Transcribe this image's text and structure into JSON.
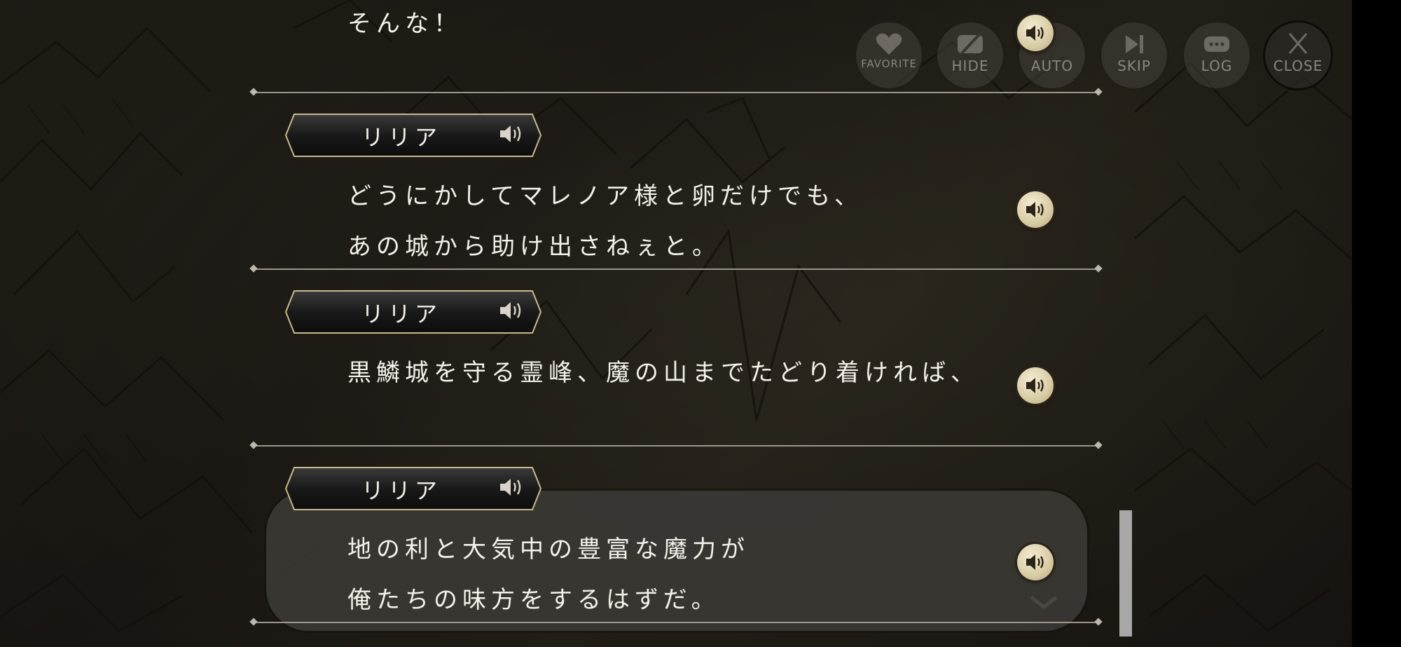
{
  "controls": {
    "favorite": "FAVORITE",
    "hide": "HIDE",
    "auto": "AUTO",
    "skip": "SKIP",
    "log": "LOG",
    "close": "CLOSE"
  },
  "log": {
    "top_fragment": "そんな！",
    "entries": [
      {
        "speaker": "リリア",
        "lines": [
          "どうにかしてマレノア様と卵だけでも、",
          "あの城から助け出さねぇと。"
        ]
      },
      {
        "speaker": "リリア",
        "lines": [
          "黒鱗城を守る霊峰、魔の山までたどり着ければ、"
        ]
      },
      {
        "speaker": "リリア",
        "lines": [
          "地の利と大気中の豊富な魔力が",
          "俺たちの味方をするはずだ。"
        ]
      }
    ]
  },
  "colors": {
    "accent_gold": "#d8cba4",
    "text": "#f4f1ea",
    "nameplate_border": "#c9b98c"
  },
  "icons": {
    "voice": "speaker-icon",
    "favorite": "heart-icon",
    "hide": "eye-slash-icon",
    "skip": "skip-icon",
    "log": "chat-bubble-icon",
    "close": "close-icon"
  }
}
